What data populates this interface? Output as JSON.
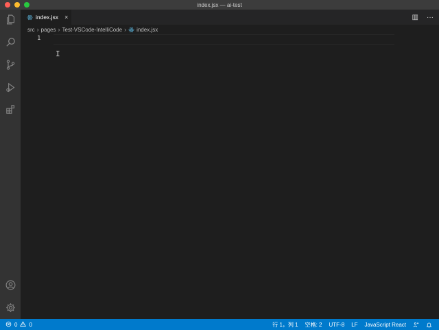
{
  "window": {
    "title": "index.jsx — ai-test"
  },
  "tabs": [
    {
      "label": "index.jsx",
      "icon": "react-icon",
      "close": "×"
    }
  ],
  "tab_actions": {
    "split": "▥",
    "more": "···"
  },
  "breadcrumb": {
    "items": [
      "src",
      "pages",
      "Test-VSCode-IntelliCode",
      "index.jsx"
    ]
  },
  "editor": {
    "line_numbers": [
      "1"
    ],
    "cursor_glyph": "I"
  },
  "statusbar": {
    "errors": "0",
    "warnings": "0",
    "position": "行 1，列 1",
    "spaces": "空格: 2",
    "encoding": "UTF-8",
    "eol": "LF",
    "language": "JavaScript React"
  },
  "colors": {
    "accent": "#007acc",
    "react": "#519aba"
  }
}
